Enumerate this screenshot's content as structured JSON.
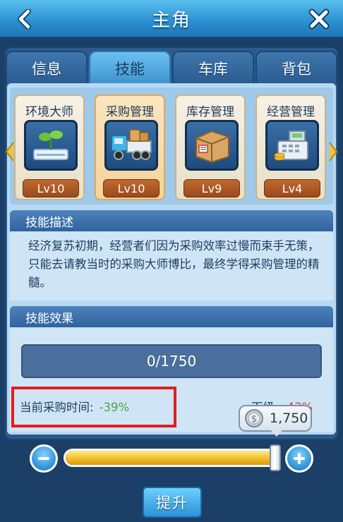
{
  "header": {
    "title": "主角"
  },
  "tabs": [
    {
      "label": "信息",
      "active": false
    },
    {
      "label": "技能",
      "active": true
    },
    {
      "label": "车库",
      "active": false
    },
    {
      "label": "背包",
      "active": false
    }
  ],
  "skills": [
    {
      "name": "环境大师",
      "level": "Lv10",
      "icon": "plant-icon"
    },
    {
      "name": "采购管理",
      "level": "Lv10",
      "icon": "truck-icon",
      "selected": true
    },
    {
      "name": "库存管理",
      "level": "Lv9",
      "icon": "box-icon"
    },
    {
      "name": "经营管理",
      "level": "Lv4",
      "icon": "cash-register-icon"
    }
  ],
  "description": {
    "heading": "技能描述",
    "text": "经济复苏初期，经营者们因为采购效率过慢而束手无策，只能去请教当时的采购大师博比，最终学得采购管理的精髓。"
  },
  "effect": {
    "heading": "技能效果",
    "progress": "0/1750",
    "current_label": "当前采购时间:",
    "current_value": "-39%",
    "next_label": "下级:",
    "next_value": "-43%",
    "cost": "1,750"
  },
  "slider": {
    "level": 1.0
  },
  "upgrade_label": "提升",
  "colors": {
    "positive": "#4aa83b",
    "negative": "#e33a3a",
    "highlight": "#e01e1e"
  }
}
